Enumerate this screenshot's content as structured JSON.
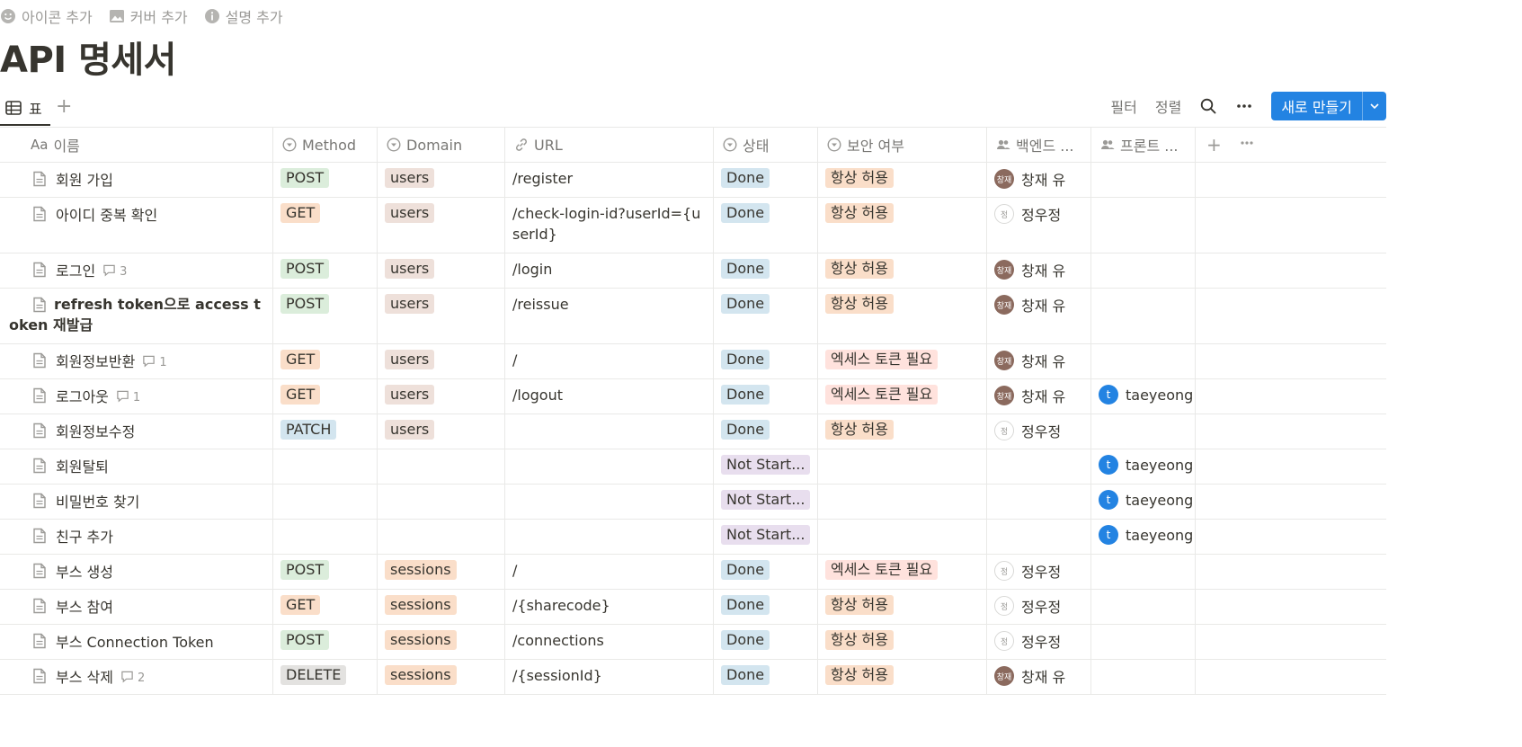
{
  "page_actions": {
    "add_icon": "아이콘 추가",
    "add_cover": "커버 추가",
    "add_description": "설명 추가"
  },
  "title": "API 명세서",
  "view": {
    "tab_label": "표",
    "filter": "필터",
    "sort": "정렬",
    "new_button": "새로 만들기"
  },
  "columns": {
    "name": "이름",
    "name_prefix": "Aa",
    "method": "Method",
    "domain": "Domain",
    "url": "URL",
    "status": "상태",
    "security": "보안 여부",
    "backend": "백엔드 ...",
    "frontend": "프론트 ..."
  },
  "rows": [
    {
      "name": "회원 가입",
      "comments": "",
      "method": "POST",
      "domain": "users",
      "url": "/register",
      "status": "Done",
      "security": "항상 허용",
      "backend": "창재 유",
      "backend_av": "창재",
      "frontend": ""
    },
    {
      "name": "아이디 중복 확인",
      "comments": "",
      "method": "GET",
      "domain": "users",
      "url": "/check-login-id?userId={userId}",
      "status": "Done",
      "security": "항상 허용",
      "backend": "정우정",
      "backend_av": "정",
      "frontend": ""
    },
    {
      "name": "로그인",
      "comments": "3",
      "method": "POST",
      "domain": "users",
      "url": "/login",
      "status": "Done",
      "security": "항상 허용",
      "backend": "창재 유",
      "backend_av": "창재",
      "frontend": ""
    },
    {
      "name": "refresh token으로 access token 재발급",
      "comments": "",
      "method": "POST",
      "domain": "users",
      "url": "/reissue",
      "status": "Done",
      "security": "항상 허용",
      "backend": "창재 유",
      "backend_av": "창재",
      "frontend": ""
    },
    {
      "name": "회원정보반환",
      "comments": "1",
      "method": "GET",
      "domain": "users",
      "url": "/",
      "status": "Done",
      "security": "엑세스 토큰 필요",
      "backend": "창재 유",
      "backend_av": "창재",
      "frontend": ""
    },
    {
      "name": "로그아웃",
      "comments": "1",
      "method": "GET",
      "domain": "users",
      "url": "/logout",
      "status": "Done",
      "security": "엑세스 토큰 필요",
      "backend": "창재 유",
      "backend_av": "창재",
      "frontend": "taeyeong y"
    },
    {
      "name": "회원정보수정",
      "comments": "",
      "method": "PATCH",
      "domain": "users",
      "url": "",
      "status": "Done",
      "security": "항상 허용",
      "backend": "정우정",
      "backend_av": "정",
      "frontend": ""
    },
    {
      "name": "회원탈퇴",
      "comments": "",
      "method": "",
      "domain": "",
      "url": "",
      "status": "Not Start...",
      "security": "",
      "backend": "",
      "backend_av": "",
      "frontend": "taeyeong y"
    },
    {
      "name": "비밀번호 찾기",
      "comments": "",
      "method": "",
      "domain": "",
      "url": "",
      "status": "Not Start...",
      "security": "",
      "backend": "",
      "backend_av": "",
      "frontend": "taeyeong y"
    },
    {
      "name": "친구 추가",
      "comments": "",
      "method": "",
      "domain": "",
      "url": "",
      "status": "Not Start...",
      "security": "",
      "backend": "",
      "backend_av": "",
      "frontend": "taeyeong y"
    },
    {
      "name": "부스 생성",
      "comments": "",
      "method": "POST",
      "domain": "sessions",
      "url": "/",
      "status": "Done",
      "security": "엑세스 토큰 필요",
      "backend": "정우정",
      "backend_av": "정",
      "frontend": ""
    },
    {
      "name": "부스 참여",
      "comments": "",
      "method": "GET",
      "domain": "sessions",
      "url": "/{sharecode}",
      "status": "Done",
      "security": "항상 허용",
      "backend": "정우정",
      "backend_av": "정",
      "frontend": ""
    },
    {
      "name": "부스 Connection Token",
      "comments": "",
      "method": "POST",
      "domain": "sessions",
      "url": "/connections",
      "status": "Done",
      "security": "항상 허용",
      "backend": "정우정",
      "backend_av": "정",
      "frontend": ""
    },
    {
      "name": "부스 삭제",
      "comments": "2",
      "method": "DELETE",
      "domain": "sessions",
      "url": "/{sessionId}",
      "status": "Done",
      "security": "항상 허용",
      "backend": "창재 유",
      "backend_av": "창재",
      "frontend": ""
    }
  ],
  "frontend_avatar_letter": "t",
  "colors": {
    "accent": "#2383e2",
    "tag_post": "#dbeddb",
    "tag_get": "#fadec9",
    "tag_patch": "#d3e5ef",
    "tag_delete": "#e3e2e0",
    "tag_users": "#eee0da",
    "tag_done": "#d3e5ef",
    "tag_not_started": "#e8deee",
    "tag_token": "#ffe2dd"
  }
}
